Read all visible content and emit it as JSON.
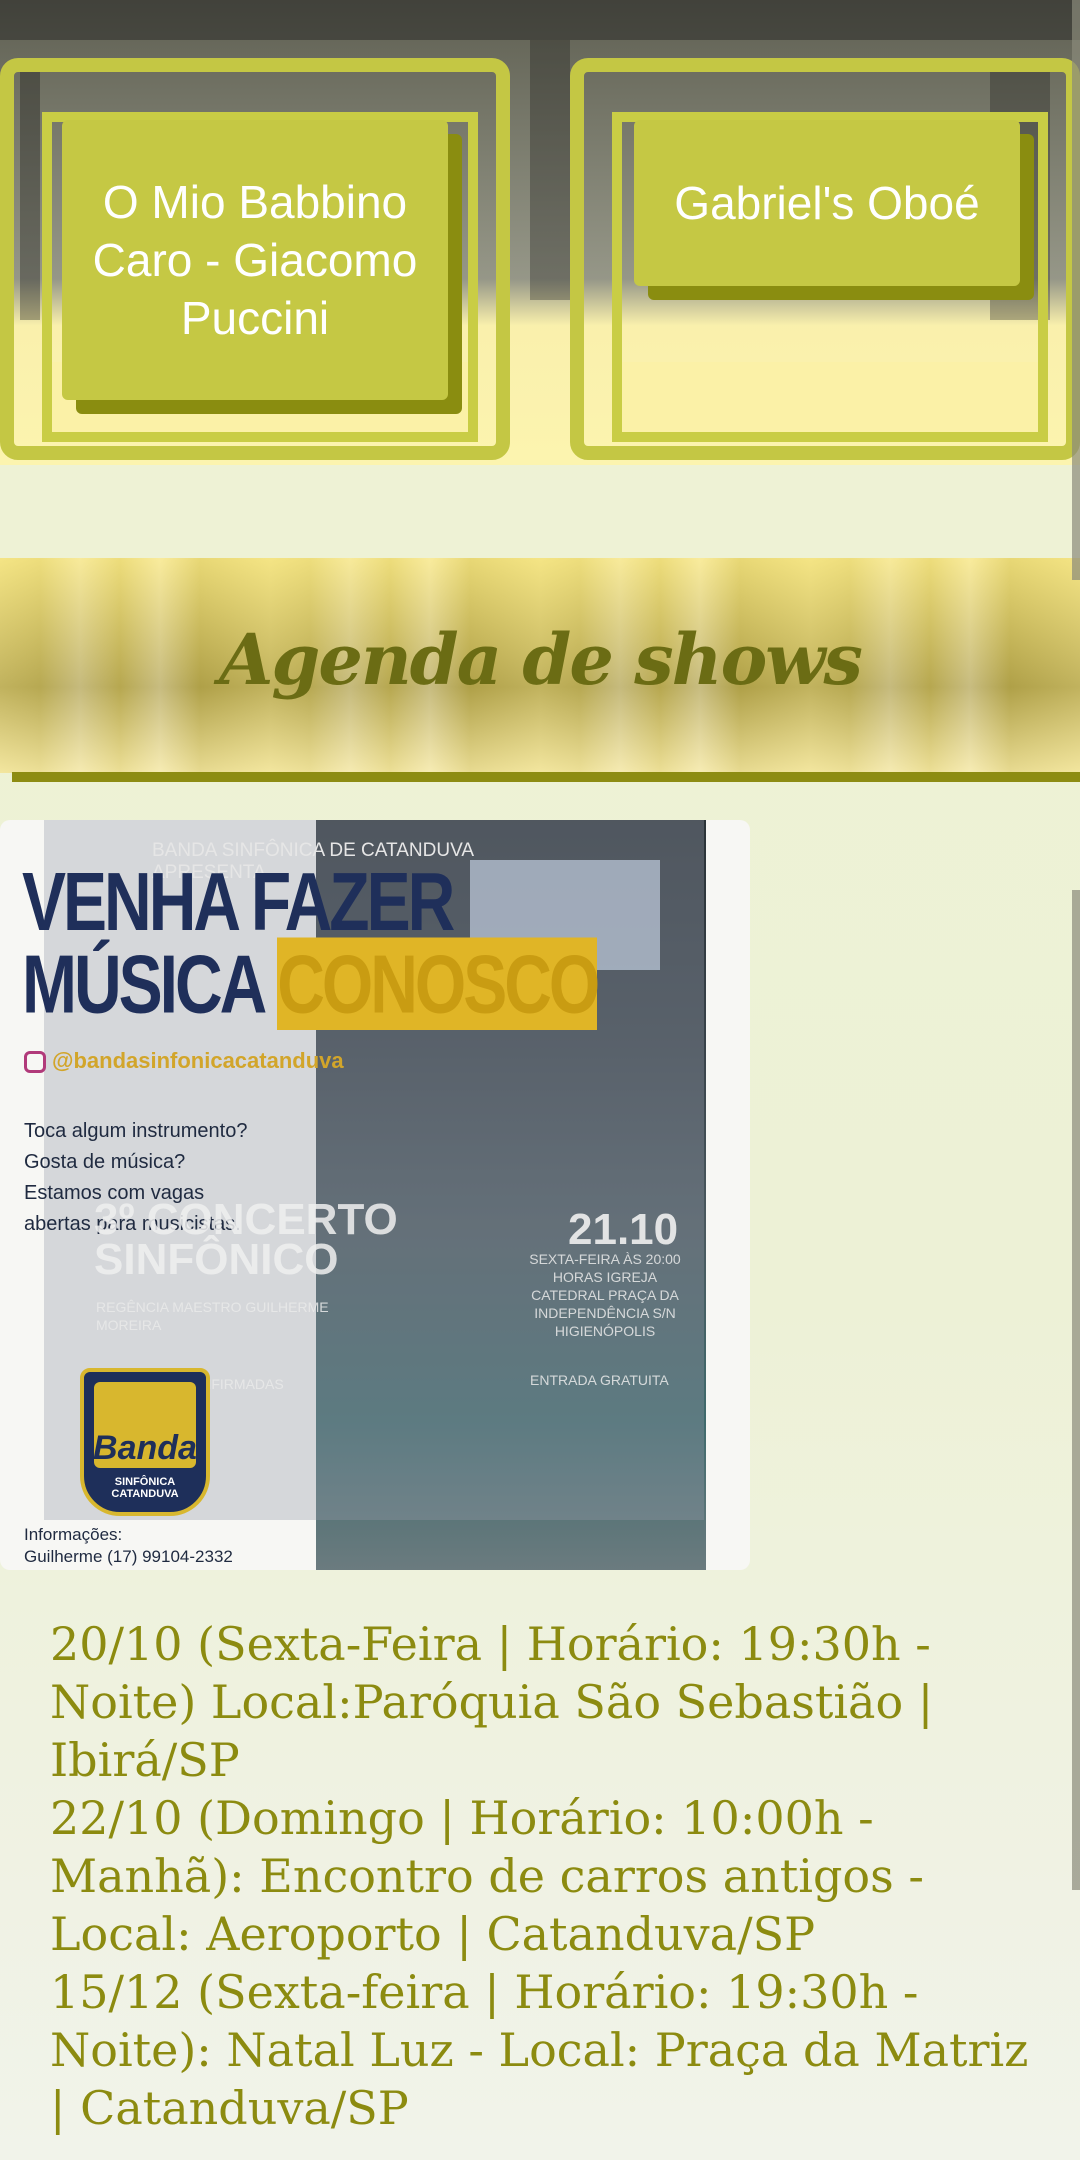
{
  "songs": [
    {
      "label": "O Mio Babbino Caro - Giacomo Puccini"
    },
    {
      "label": "Gabriel's Oboé"
    }
  ],
  "agenda": {
    "title": "Agenda de shows"
  },
  "poster": {
    "headline_1": "VENHA FAZER",
    "headline_2a": "MÚSICA ",
    "headline_2b": "CONOSCO",
    "presenter": "BANDA SINFÔNICA DE CATANDUVA APRESENTA",
    "instagram": "@bandasinfonicacatanduva",
    "body": "Toca algum instrumento? Gosta de música? Estamos com vagas abertas para musicistas.",
    "concert": "3º CONCERTO SINFÔNICO",
    "date": "21.10",
    "regencia": "REGÊNCIA MAESTRO GUILHERME MOREIRA",
    "venue": "SEXTA-FEIRA ÀS 20:00 HORAS IGREJA CATEDRAL PRAÇA DA INDEPENDÊNCIA S/N HIGIENÓPOLIS",
    "presencas": "PRESENÇAS CONFIRMADAS",
    "entrada": "ENTRADA GRATUITA",
    "logo_word": "Banda",
    "logo_caption": "SINFÔNICA CATANDUVA",
    "info_1": "Informações:",
    "info_2": "Guilherme (17) 99104-2332"
  },
  "events": [
    "20/10 (Sexta-Feira | Horário: 19:30h - Noite) Local:Paróquia São Sebastião | Ibirá/SP",
    "22/10 (Domingo | Horário: 10:00h - Manhã): Encontro de carros antigos - Local: Aeroporto | Catanduva/SP",
    "15/12 (Sexta-feira | Horário: 19:30h - Noite): Natal Luz - Local: Praça da Matriz | Catanduva/SP"
  ],
  "colors": {
    "accent": "#c5c844",
    "accent_dark": "#8d8c12",
    "text": "#8c8b10",
    "background": "#eef3d4"
  }
}
